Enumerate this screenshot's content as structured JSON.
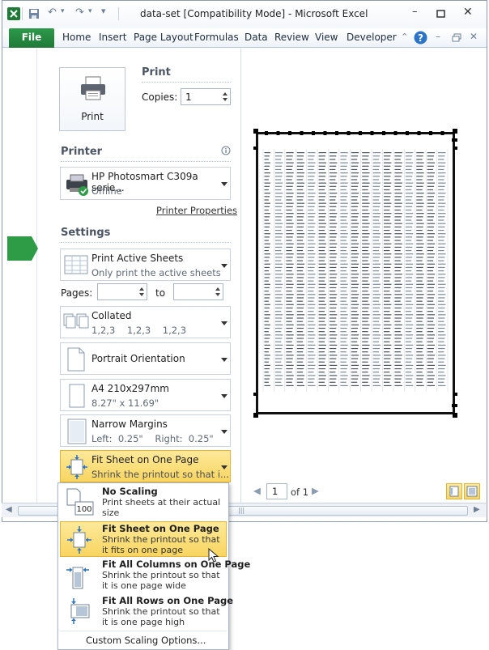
{
  "window": {
    "title": "data-set  [Compatibility Mode]  -  Microsoft Excel"
  },
  "ribbon": {
    "file_tab": "File",
    "tabs": [
      "Home",
      "Insert",
      "Page Layout",
      "Formulas",
      "Data",
      "Review",
      "View",
      "Developer"
    ]
  },
  "print": {
    "button_label": "Print",
    "section_title": "Print",
    "copies_label": "Copies:",
    "copies_value": "1"
  },
  "printer": {
    "section_title": "Printer",
    "name": "HP Photosmart C309a serie...",
    "status": "Offline",
    "properties_link": "Printer Properties"
  },
  "settings": {
    "section_title": "Settings",
    "what": {
      "title": "Print Active Sheets",
      "desc": "Only print the active sheets"
    },
    "pages_label": "Pages:",
    "to_label": "to",
    "collate": {
      "title": "Collated",
      "desc": "1,2,3    1,2,3    1,2,3"
    },
    "orientation": {
      "title": "Portrait Orientation"
    },
    "paper": {
      "title": "A4 210x297mm",
      "desc": "8.27\" x 11.69\""
    },
    "margins": {
      "title": "Narrow Margins",
      "desc": "Left:  0.25\"    Right:  0.25\""
    },
    "scaling": {
      "title": "Fit Sheet on One Page",
      "desc": "Shrink the printout so that i..."
    }
  },
  "scaling_menu": {
    "items": [
      {
        "title": "No Scaling",
        "desc": "Print sheets at their actual size",
        "icon_text": "100"
      },
      {
        "title": "Fit Sheet on One Page",
        "desc": "Shrink the printout so that it fits on one page"
      },
      {
        "title": "Fit All Columns on One Page",
        "desc": "Shrink the printout so that it is one page wide"
      },
      {
        "title": "Fit All Rows on One Page",
        "desc": "Shrink the printout so that it is one page high"
      }
    ],
    "custom": "Custom Scaling Options..."
  },
  "preview_nav": {
    "page_value": "1",
    "of_label": "of 1"
  },
  "colors": {
    "file_green": "#1f7a38",
    "highlight": "#f8d560",
    "accent_blue": "#2b73c9"
  }
}
